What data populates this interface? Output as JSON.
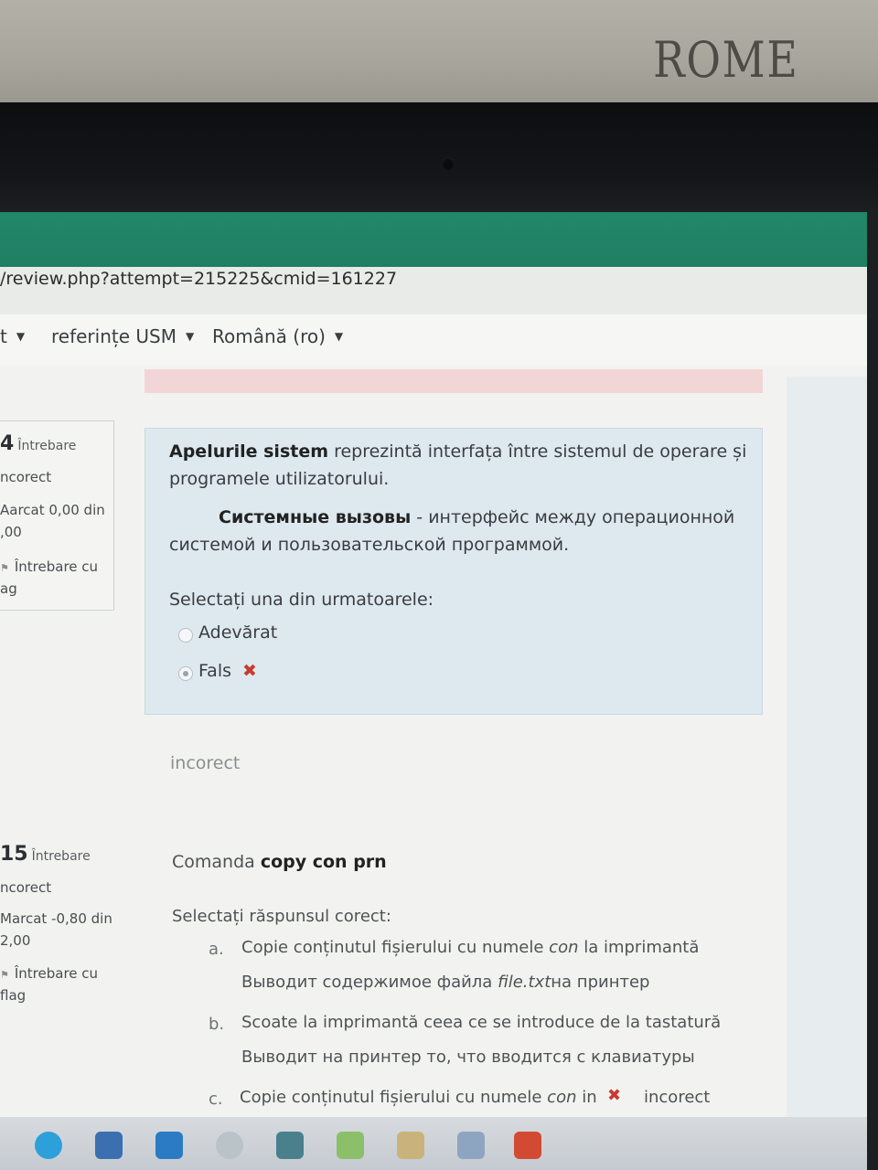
{
  "environment": {
    "wall_sign": "ROME"
  },
  "browser": {
    "url": "/review.php?attempt=215225&cmid=161227"
  },
  "nav": {
    "items": [
      "t",
      "referințe USM",
      "Română (ro)"
    ]
  },
  "question14": {
    "number": "4",
    "label": "Întrebare",
    "status": "ncorect",
    "mark_line1": "Aarcat 0,00 din",
    "mark_line2": ",00",
    "flag_line1": "Întrebare cu",
    "flag_line2": "ag",
    "text_ro_bold": "Apelurile sistem",
    "text_ro_rest": " reprezintă interfața între sistemul de operare și",
    "text_ro_line2": "programele utilizatorului.",
    "text_ru_bold": "Системные вызовы",
    "text_ru_rest": " - интерфейс между операционной",
    "text_ru_line2": "системой и пользовательской программой.",
    "prompt": "Selectați una din urmatoarele:",
    "options": [
      "Adevărat",
      "Fals"
    ],
    "selected": 1,
    "wrong_mark": "✖",
    "feedback": "incorect"
  },
  "question15": {
    "number": "15",
    "label": "Întrebare",
    "status": "ncorect",
    "mark_line1": "Marcat -0,80 din",
    "mark_line2": "2,00",
    "flag_line1": "Întrebare cu",
    "flag_line2": "flag",
    "text_prefix": "Comanda ",
    "text_bold": "copy con prn",
    "prompt": "Selectați răspunsul corect:",
    "answers": [
      {
        "letter": "a.",
        "ro": "Copie conținutul fișierului cu numele ",
        "ro_italic": "con",
        "ro_end": " la imprimantă",
        "ru": "Выводит содержимое файла ",
        "ru_italic": "file.txt",
        "ru_end": "на принтер"
      },
      {
        "letter": "b.",
        "ro": "Scoate la imprimantă ceea ce se introduce de la tastatură",
        "ru": "Выводит на принтер то, что вводится с клавиатуры"
      },
      {
        "letter": "c.",
        "ro": "Copie conținutul fișierului cu numele ",
        "ro_italic": "con",
        "ro_end": " in",
        "mark": "✖",
        "status": "incorect"
      }
    ]
  },
  "colors": {
    "header_green": "#1f7f63",
    "question_bg": "#dde9ef",
    "error_red": "#c83a2f",
    "strip_pink": "#f1d6d5"
  },
  "taskbar_icons": [
    "telegram-icon",
    "store-icon",
    "mail-icon",
    "chrome-icon",
    "box-icon",
    "chart-icon",
    "paint-icon",
    "tablet-icon",
    "powerpoint-icon"
  ]
}
